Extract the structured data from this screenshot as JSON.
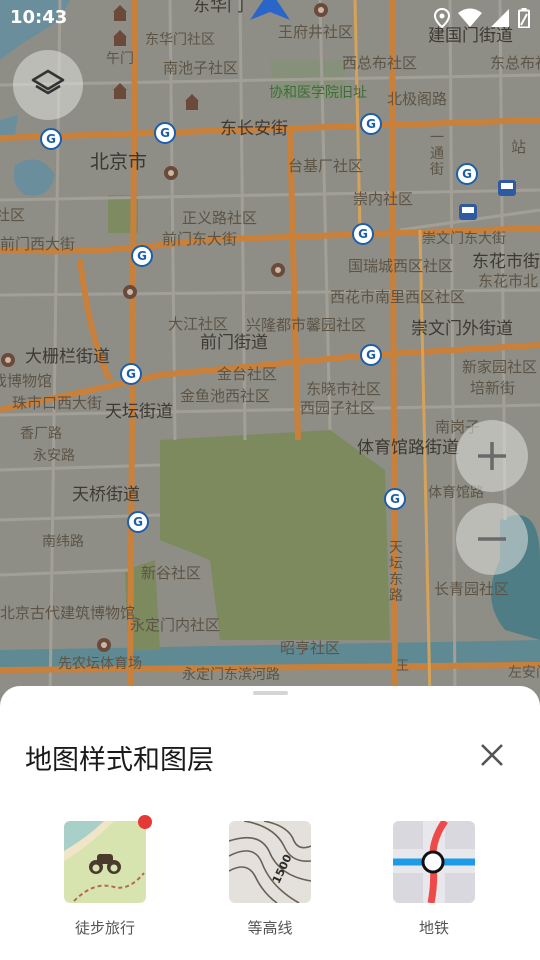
{
  "status_bar": {
    "time": "10:43",
    "icons": [
      "location-icon",
      "wifi-icon",
      "cell-signal-icon",
      "battery-icon"
    ]
  },
  "map": {
    "labels": {
      "dhm": "东华门",
      "dhmsq": "东华门社区",
      "wfjsq": "王府井社区",
      "jgmjd": "建国门街道",
      "wm": "午门",
      "nczsq": "南池子社区",
      "xslsq": "西总布社区",
      "dzsq": "东总布社区",
      "xhyy": "协和医学院旧址",
      "bjlh": "北极阁路",
      "dcaj": "东长安街",
      "bjs": "北京市",
      "tjcsq": "台基厂社区",
      "chongnei": "崇内社区",
      "zhan": "站",
      "zhengyi": "正义路社区",
      "qianmenxi": "前门西大街",
      "qianmendong": "前门东大街",
      "chongwenmendong": "崇文门东大街",
      "guorui": "国瑞城西区社区",
      "dongshi": "东花市街",
      "dongshibei": "东花市北",
      "xishi": "西花市南里西区社区",
      "dajiang": "大江社区",
      "xingbu": "兴隆都市馨园社区",
      "chongwai": "崇文门外街道",
      "qianmenjd": "前门街道",
      "dashilan": "大栅栏街道",
      "bowuguan": "戏博物馆",
      "jintai": "金台社区",
      "dongxiao": "东晓市社区",
      "xinjia": "新家园社区",
      "peixin": "培新街",
      "zhushikou": "珠市口西大街",
      "jinyu": "金鱼池西社区",
      "xiyuan": "西园子社区",
      "tiantan": "天坛街道",
      "xiangchang": "香厂路",
      "yongan": "永安路",
      "tiyuguan": "体育馆路街道",
      "nangang": "南岗子",
      "tianqiao": "天桥街道",
      "tiyuguanlu": "体育馆路",
      "nanwei": "南纬路",
      "tiantandong": "天坛东路",
      "xingu": "新谷社区",
      "changqing": "长青园社区",
      "gudai": "北京古代建筑博物馆",
      "yongdingmen": "永定门内社区",
      "zhaoting": "昭亨社区",
      "xiannong": "先农坛体育场",
      "yongdinghe": "永定门东滨河路",
      "zuo": "左安门",
      "wang": "王",
      "yitong": "一通街",
      "junshi": "君社区"
    }
  },
  "controls": {
    "layers_icon": "layers-icon",
    "zoom_in_icon": "plus-icon",
    "zoom_out_icon": "minus-icon"
  },
  "sheet": {
    "title": "地图样式和图层",
    "close_icon": "close-icon",
    "options": [
      {
        "label": "徒步旅行",
        "icon": "hiking-binoculars-icon",
        "badge": true
      },
      {
        "label": "等高线",
        "icon": "contour-lines-icon",
        "contour_value": "1500"
      },
      {
        "label": "地铁",
        "icon": "subway-icon"
      }
    ]
  }
}
